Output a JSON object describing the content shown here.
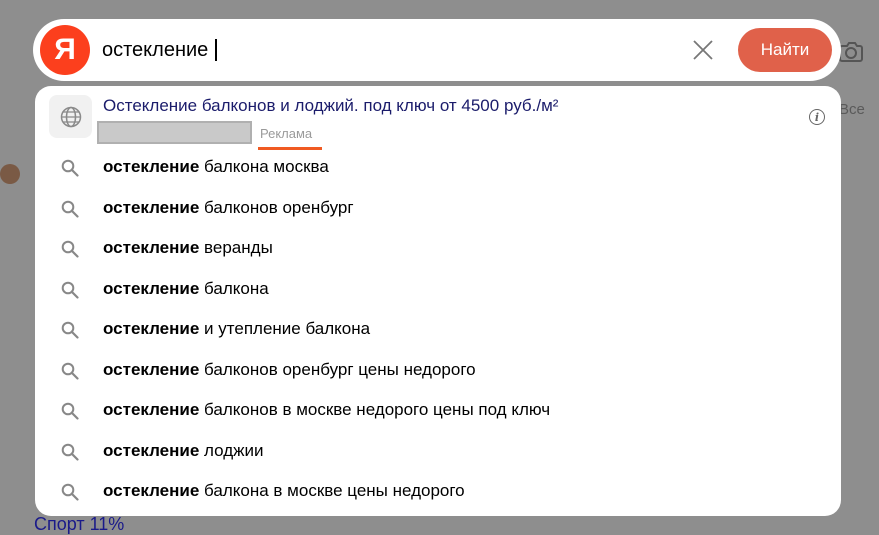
{
  "background": {
    "right_text": "Все",
    "bottom_link": "Спорт 11%"
  },
  "search": {
    "logo_letter": "Я",
    "value": "остекление",
    "find_label": "Найти"
  },
  "ad": {
    "title": "Остекление балконов и лоджий. под ключ от 4500 руб./м²",
    "label": "Реклама"
  },
  "suggestions": [
    {
      "bold": "остекление",
      "rest": " балкона москва"
    },
    {
      "bold": "остекление",
      "rest": " балконов оренбург"
    },
    {
      "bold": "остекление",
      "rest": " веранды"
    },
    {
      "bold": "остекление",
      "rest": " балкона"
    },
    {
      "bold": "остекление",
      "rest": " и утепление балкона"
    },
    {
      "bold": "остекление",
      "rest": " балконов оренбург цены недорого"
    },
    {
      "bold": "остекление",
      "rest": " балконов в москве недорого цены под ключ"
    },
    {
      "bold": "остекление",
      "rest": " лоджии"
    },
    {
      "bold": "остекление",
      "rest": " балкона в москве цены недорого"
    }
  ],
  "colors": {
    "logo": "#fc3f1d",
    "find_button": "#e0614a",
    "ad_title": "#1b1c6b",
    "ad_underline": "#f05a22"
  },
  "icons": {
    "clear": "close-icon",
    "camera": "camera-icon",
    "ad": "globe-icon",
    "suggestion": "search-icon",
    "info": "info-icon"
  }
}
